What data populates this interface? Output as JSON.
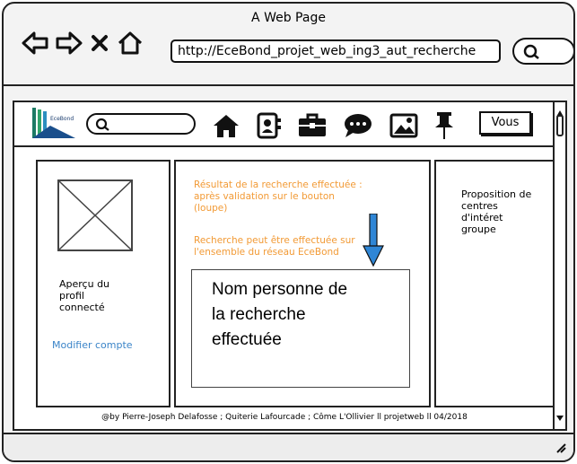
{
  "browser": {
    "title": "A Web Page",
    "url": "http://EceBond_projet_web_ing3_aut_recherche"
  },
  "topbar": {
    "logo_text": "EceBond",
    "vous_label": "Vous",
    "icons": [
      "home-icon",
      "contacts-icon",
      "briefcase-icon",
      "chat-icon",
      "image-icon",
      "pin-icon"
    ]
  },
  "profile": {
    "label": "Aperçu du\nprofil\nconnecté",
    "modify_link": "Modifier compte"
  },
  "results": {
    "note1": "Résultat de la recherche effectuée :\naprès validation sur le bouton\n(loupe)",
    "note2": "Recherche peut être effectuée sur\nl'ensemble du réseau EceBond",
    "box_text": "Nom personne de\nla recherche\neffectuée"
  },
  "proposition": {
    "label": "Proposition de\ncentres\nd'intéret\ngroupe"
  },
  "footer": {
    "credits": "@by Pierre-Joseph Delafosse ; Quiterie Lafourcade ; Côme L'Ollivier ll projetweb ll 04/2018"
  },
  "colors": {
    "accent_orange": "#f29a35",
    "link_blue": "#3a84c8",
    "arrow_blue": "#2f86d6"
  }
}
